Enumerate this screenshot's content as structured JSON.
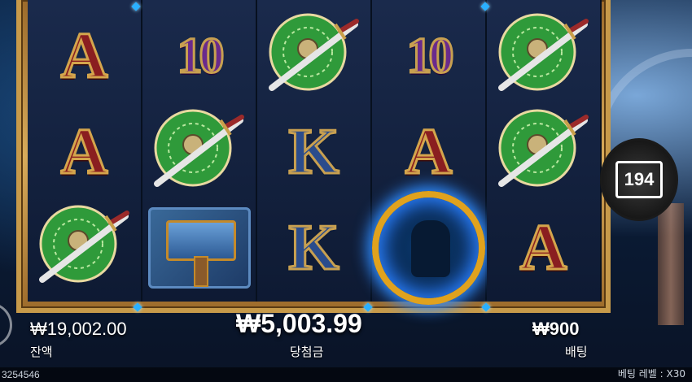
{
  "colors": {
    "frame_gold": "#c79a4a",
    "reel_bg": "#0f1d38",
    "text": "#ffffff"
  },
  "reels": [
    {
      "symbols": [
        "A",
        "A",
        "shield"
      ]
    },
    {
      "symbols": [
        "10",
        "shield",
        "hammer"
      ]
    },
    {
      "symbols": [
        "shield",
        "K",
        "K"
      ]
    },
    {
      "symbols": [
        "10",
        "A",
        "wild"
      ]
    },
    {
      "symbols": [
        "shield",
        "shield",
        "A"
      ]
    }
  ],
  "balance": {
    "value": "₩19,002.00",
    "label": "잔액"
  },
  "win": {
    "value": "₩5,003.99",
    "label": "당첨금"
  },
  "bet": {
    "value": "₩900",
    "label": "배팅"
  },
  "counter": {
    "value": "194"
  },
  "footer": {
    "left_text": "3254546",
    "right_text": "베팅 레벨 : X30"
  }
}
